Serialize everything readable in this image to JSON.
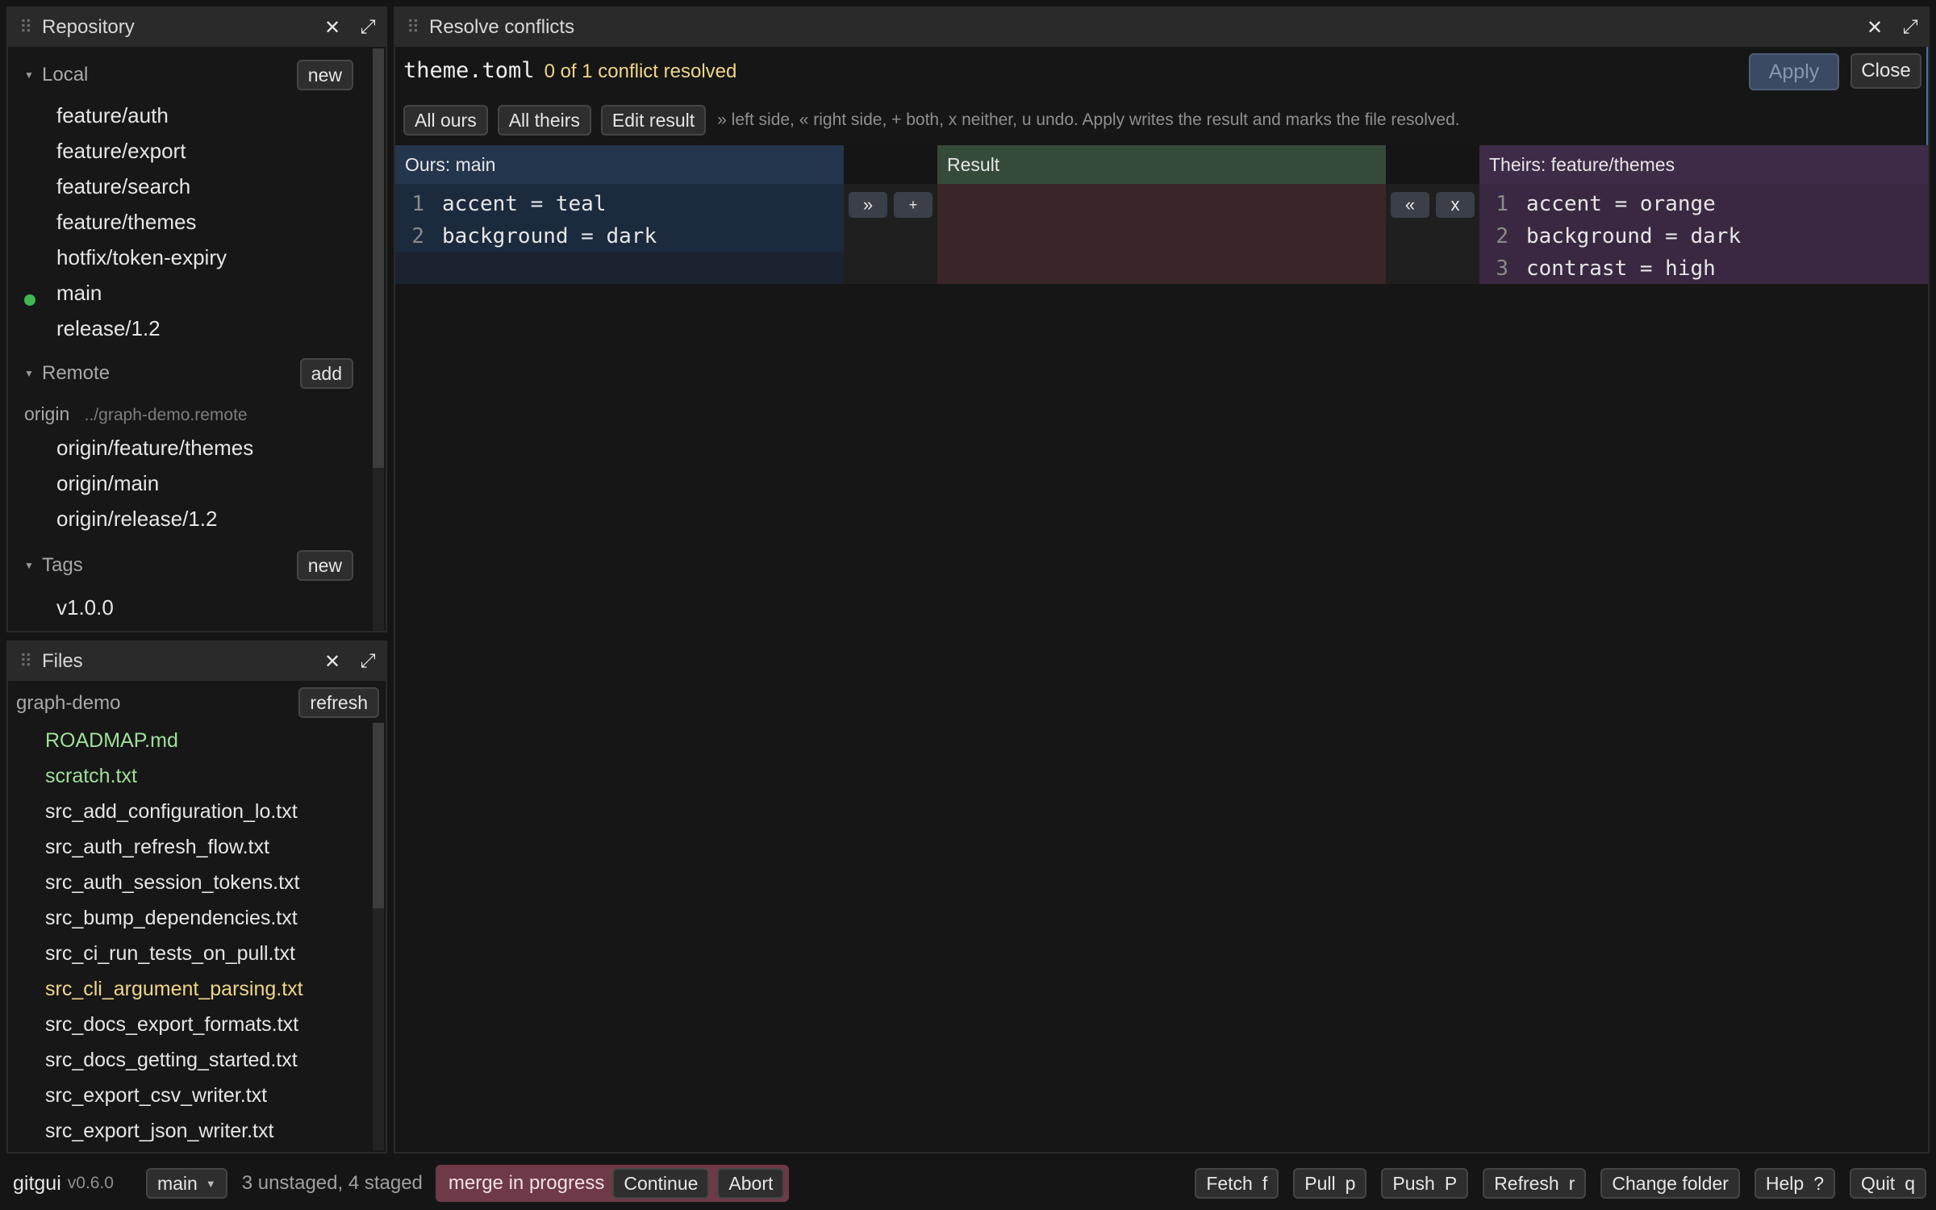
{
  "repository_panel": {
    "title": "Repository",
    "local": {
      "label": "Local",
      "button": "new",
      "branches": [
        {
          "name": "feature/auth",
          "current": false
        },
        {
          "name": "feature/export",
          "current": false
        },
        {
          "name": "feature/search",
          "current": false
        },
        {
          "name": "feature/themes",
          "current": false
        },
        {
          "name": "hotfix/token-expiry",
          "current": false
        },
        {
          "name": "main",
          "current": true
        },
        {
          "name": "release/1.2",
          "current": false
        }
      ]
    },
    "remote": {
      "label": "Remote",
      "button": "add",
      "remote_name": "origin",
      "remote_path": "../graph-demo.remote",
      "branches": [
        "origin/feature/themes",
        "origin/main",
        "origin/release/1.2"
      ]
    },
    "tags": {
      "label": "Tags",
      "button": "new",
      "items": [
        "v1.0.0"
      ]
    }
  },
  "files_panel": {
    "title": "Files",
    "folder": "graph-demo",
    "refresh": "refresh",
    "files": [
      {
        "name": "ROADMAP.md",
        "status": "untracked"
      },
      {
        "name": "scratch.txt",
        "status": "untracked"
      },
      {
        "name": "src_add_configuration_lo.txt",
        "status": "clean"
      },
      {
        "name": "src_auth_refresh_flow.txt",
        "status": "clean"
      },
      {
        "name": "src_auth_session_tokens.txt",
        "status": "clean"
      },
      {
        "name": "src_bump_dependencies.txt",
        "status": "clean"
      },
      {
        "name": "src_ci_run_tests_on_pull.txt",
        "status": "clean"
      },
      {
        "name": "src_cli_argument_parsing.txt",
        "status": "modified"
      },
      {
        "name": "src_docs_export_formats.txt",
        "status": "clean"
      },
      {
        "name": "src_docs_getting_started.txt",
        "status": "clean"
      },
      {
        "name": "src_export_csv_writer.txt",
        "status": "clean"
      },
      {
        "name": "src_export_json_writer.txt",
        "status": "clean"
      }
    ]
  },
  "conflict_panel": {
    "title": "Resolve conflicts",
    "filename": "theme.toml",
    "progress": "0 of 1 conflict resolved",
    "apply": "Apply",
    "close": "Close",
    "all_ours": "All ours",
    "all_theirs": "All theirs",
    "edit_result": "Edit result",
    "hint": "» left side, « right side, + both, x neither, u undo. Apply writes the result and marks the file resolved.",
    "ours_header": "Ours: main",
    "result_header": "Result",
    "theirs_header": "Theirs: feature/themes",
    "ours_lines": [
      {
        "num": "1",
        "text": "accent = teal"
      },
      {
        "num": "2",
        "text": "background = dark"
      }
    ],
    "theirs_lines": [
      {
        "num": "1",
        "text": "accent = orange"
      },
      {
        "num": "2",
        "text": "background = dark"
      },
      {
        "num": "3",
        "text": "contrast = high"
      }
    ],
    "take_left": "»",
    "take_both": "+",
    "take_right": "«",
    "take_neither": "x"
  },
  "status_bar": {
    "app_name": "gitgui",
    "version": "v0.6.0",
    "branch": "main",
    "changes": "3 unstaged, 4 staged",
    "merge_label": "merge in progress",
    "continue": "Continue",
    "abort": "Abort",
    "actions": [
      {
        "label": "Fetch",
        "key": "f"
      },
      {
        "label": "Pull",
        "key": "p"
      },
      {
        "label": "Push",
        "key": "P"
      },
      {
        "label": "Refresh",
        "key": "r"
      },
      {
        "label": "Change folder",
        "key": ""
      },
      {
        "label": "Help",
        "key": "?"
      },
      {
        "label": "Quit",
        "key": "q"
      }
    ]
  },
  "colors": {
    "accent_current_branch": "#3fb950",
    "untracked_file": "#9fe09a",
    "modified_file": "#f0d68a",
    "progress_text": "#f0d68a",
    "ours_bg": "#1c2a3e",
    "result_bg": "#3a2629",
    "theirs_bg": "#3a2842",
    "merge_badge_bg": "#6e3a48"
  }
}
